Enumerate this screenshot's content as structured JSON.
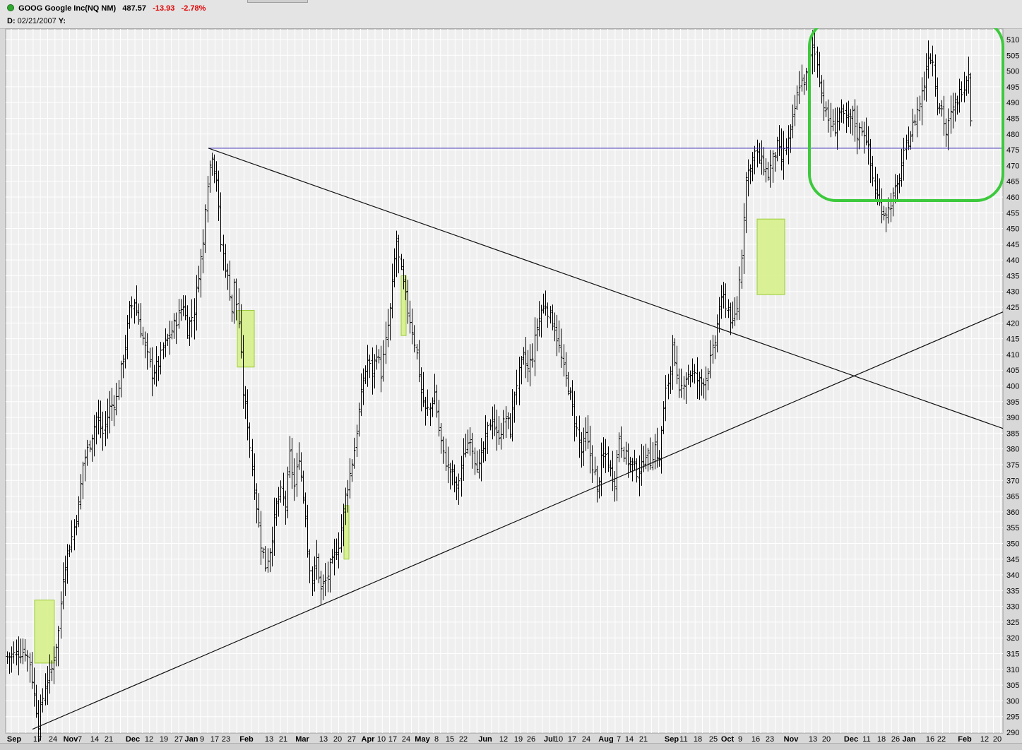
{
  "header": {
    "symbol": "GOOG",
    "name": "Google Inc(NQ NM)",
    "last": "487.57",
    "change": "-13.93",
    "pct": "-2.78%",
    "date_label": "D:",
    "date": "02/21/2007",
    "y_label": "Y:"
  },
  "chart_data": {
    "type": "ohlc",
    "period": "daily",
    "ylim": [
      290,
      513
    ],
    "y_ticks": [
      290,
      295,
      300,
      305,
      310,
      315,
      320,
      325,
      330,
      335,
      340,
      345,
      350,
      355,
      360,
      365,
      370,
      375,
      380,
      385,
      390,
      395,
      400,
      405,
      410,
      415,
      420,
      425,
      430,
      435,
      440,
      445,
      450,
      455,
      460,
      465,
      470,
      475,
      480,
      485,
      490,
      495,
      500,
      505,
      510
    ],
    "x_labels": [
      {
        "t": "Sep",
        "b": true
      },
      {
        "t": "17",
        "b": false
      },
      {
        "t": "24",
        "b": false
      },
      {
        "t": "Nov",
        "b": true
      },
      {
        "t": "7",
        "b": false
      },
      {
        "t": "14",
        "b": false
      },
      {
        "t": "21",
        "b": false
      },
      {
        "t": "Dec",
        "b": true
      },
      {
        "t": "12",
        "b": false
      },
      {
        "t": "19",
        "b": false
      },
      {
        "t": "27",
        "b": false
      },
      {
        "t": "Jan",
        "b": true
      },
      {
        "t": "9",
        "b": false
      },
      {
        "t": "17",
        "b": false
      },
      {
        "t": "23",
        "b": false
      },
      {
        "t": "Feb",
        "b": true
      },
      {
        "t": "13",
        "b": false
      },
      {
        "t": "21",
        "b": false
      },
      {
        "t": "Mar",
        "b": true
      },
      {
        "t": "13",
        "b": false
      },
      {
        "t": "20",
        "b": false
      },
      {
        "t": "27",
        "b": false
      },
      {
        "t": "Apr",
        "b": true
      },
      {
        "t": "10",
        "b": false
      },
      {
        "t": "17",
        "b": false
      },
      {
        "t": "24",
        "b": false
      },
      {
        "t": "May",
        "b": true
      },
      {
        "t": "8",
        "b": false
      },
      {
        "t": "15",
        "b": false
      },
      {
        "t": "22",
        "b": false
      },
      {
        "t": "Jun",
        "b": true
      },
      {
        "t": "12",
        "b": false
      },
      {
        "t": "19",
        "b": false
      },
      {
        "t": "26",
        "b": false
      },
      {
        "t": "Jul",
        "b": true
      },
      {
        "t": "10",
        "b": false
      },
      {
        "t": "17",
        "b": false
      },
      {
        "t": "24",
        "b": false
      },
      {
        "t": "Aug",
        "b": true
      },
      {
        "t": "7",
        "b": false
      },
      {
        "t": "14",
        "b": false
      },
      {
        "t": "21",
        "b": false
      },
      {
        "t": "Sep",
        "b": true
      },
      {
        "t": "11",
        "b": false
      },
      {
        "t": "18",
        "b": false
      },
      {
        "t": "25",
        "b": false
      },
      {
        "t": "Oct",
        "b": true
      },
      {
        "t": "9",
        "b": false
      },
      {
        "t": "16",
        "b": false
      },
      {
        "t": "23",
        "b": false
      },
      {
        "t": "Nov",
        "b": true
      },
      {
        "t": "13",
        "b": false
      },
      {
        "t": "20",
        "b": false
      },
      {
        "t": "Dec",
        "b": true
      },
      {
        "t": "11",
        "b": false
      },
      {
        "t": "18",
        "b": false
      },
      {
        "t": "26",
        "b": false
      },
      {
        "t": "Jan",
        "b": true
      },
      {
        "t": "16",
        "b": false
      },
      {
        "t": "22",
        "b": false
      },
      {
        "t": "Feb",
        "b": true
      },
      {
        "t": "12",
        "b": false
      },
      {
        "t": "20",
        "b": false
      }
    ],
    "price_path": [
      [
        0,
        314
      ],
      [
        8,
        316
      ],
      [
        10,
        312
      ],
      [
        12,
        302
      ],
      [
        14,
        293
      ],
      [
        17,
        305
      ],
      [
        20,
        310
      ],
      [
        23,
        322
      ],
      [
        25,
        340
      ],
      [
        27,
        347
      ],
      [
        29,
        352
      ],
      [
        32,
        362
      ],
      [
        34,
        375
      ],
      [
        37,
        382
      ],
      [
        40,
        390
      ],
      [
        43,
        385
      ],
      [
        46,
        393
      ],
      [
        49,
        396
      ],
      [
        51,
        405
      ],
      [
        53,
        413
      ],
      [
        55,
        424
      ],
      [
        57,
        427
      ],
      [
        60,
        418
      ],
      [
        62,
        412
      ],
      [
        65,
        404
      ],
      [
        68,
        407
      ],
      [
        70,
        412
      ],
      [
        73,
        416
      ],
      [
        76,
        421
      ],
      [
        79,
        426
      ],
      [
        81,
        418
      ],
      [
        84,
        424
      ],
      [
        86,
        436
      ],
      [
        88,
        445
      ],
      [
        89,
        458
      ],
      [
        90,
        465
      ],
      [
        91,
        470
      ],
      [
        92,
        474
      ],
      [
        93,
        469
      ],
      [
        94,
        466
      ],
      [
        96,
        445
      ],
      [
        98,
        438
      ],
      [
        100,
        430
      ],
      [
        101,
        424
      ],
      [
        102,
        432
      ],
      [
        104,
        420
      ],
      [
        106,
        398
      ],
      [
        108,
        388
      ],
      [
        110,
        374
      ],
      [
        112,
        362
      ],
      [
        114,
        350
      ],
      [
        116,
        343
      ],
      [
        118,
        348
      ],
      [
        121,
        362
      ],
      [
        123,
        366
      ],
      [
        125,
        362
      ],
      [
        127,
        378
      ],
      [
        129,
        368
      ],
      [
        131,
        378
      ],
      [
        133,
        365
      ],
      [
        134,
        360
      ],
      [
        135,
        348
      ],
      [
        137,
        338
      ],
      [
        139,
        345
      ],
      [
        141,
        335
      ],
      [
        143,
        338
      ],
      [
        145,
        342
      ],
      [
        147,
        346
      ],
      [
        149,
        350
      ],
      [
        152,
        365
      ],
      [
        154,
        372
      ],
      [
        156,
        380
      ],
      [
        158,
        392
      ],
      [
        160,
        402
      ],
      [
        162,
        408
      ],
      [
        164,
        404
      ],
      [
        166,
        411
      ],
      [
        168,
        404
      ],
      [
        170,
        414
      ],
      [
        172,
        424
      ],
      [
        174,
        440
      ],
      [
        175,
        446
      ],
      [
        176,
        440
      ],
      [
        178,
        432
      ],
      [
        180,
        424
      ],
      [
        182,
        418
      ],
      [
        184,
        410
      ],
      [
        186,
        398
      ],
      [
        188,
        392
      ],
      [
        190,
        393
      ],
      [
        192,
        398
      ],
      [
        194,
        386
      ],
      [
        196,
        378
      ],
      [
        198,
        374
      ],
      [
        200,
        372
      ],
      [
        202,
        367
      ],
      [
        204,
        374
      ],
      [
        206,
        380
      ],
      [
        208,
        384
      ],
      [
        210,
        377
      ],
      [
        212,
        374
      ],
      [
        214,
        380
      ],
      [
        216,
        386
      ],
      [
        218,
        390
      ],
      [
        220,
        384
      ],
      [
        222,
        386
      ],
      [
        224,
        390
      ],
      [
        226,
        386
      ],
      [
        228,
        398
      ],
      [
        230,
        404
      ],
      [
        232,
        409
      ],
      [
        234,
        405
      ],
      [
        236,
        410
      ],
      [
        238,
        419
      ],
      [
        240,
        424
      ],
      [
        242,
        426
      ],
      [
        244,
        422
      ],
      [
        246,
        419
      ],
      [
        248,
        412
      ],
      [
        250,
        405
      ],
      [
        252,
        400
      ],
      [
        254,
        393
      ],
      [
        256,
        386
      ],
      [
        258,
        379
      ],
      [
        260,
        384
      ],
      [
        262,
        378
      ],
      [
        264,
        372
      ],
      [
        265,
        366
      ],
      [
        267,
        376
      ],
      [
        269,
        378
      ],
      [
        271,
        373
      ],
      [
        273,
        370
      ],
      [
        275,
        384
      ],
      [
        277,
        379
      ],
      [
        279,
        376
      ],
      [
        281,
        375
      ],
      [
        283,
        373
      ],
      [
        285,
        374
      ],
      [
        287,
        379
      ],
      [
        289,
        376
      ],
      [
        291,
        381
      ],
      [
        293,
        376
      ],
      [
        294,
        386
      ],
      [
        296,
        398
      ],
      [
        298,
        405
      ],
      [
        299,
        415
      ],
      [
        300,
        406
      ],
      [
        302,
        397
      ],
      [
        304,
        402
      ],
      [
        306,
        404
      ],
      [
        308,
        404
      ],
      [
        310,
        402
      ],
      [
        312,
        401
      ],
      [
        314,
        403
      ],
      [
        316,
        408
      ],
      [
        318,
        414
      ],
      [
        320,
        425
      ],
      [
        322,
        428
      ],
      [
        324,
        424
      ],
      [
        326,
        419
      ],
      [
        328,
        425
      ],
      [
        330,
        442
      ],
      [
        331,
        455
      ],
      [
        332,
        466
      ],
      [
        334,
        470
      ],
      [
        336,
        474
      ],
      [
        338,
        472
      ],
      [
        340,
        470
      ],
      [
        342,
        467
      ],
      [
        344,
        472
      ],
      [
        346,
        476
      ],
      [
        348,
        472
      ],
      [
        350,
        476
      ],
      [
        352,
        480
      ],
      [
        354,
        488
      ],
      [
        356,
        496
      ],
      [
        358,
        497
      ],
      [
        360,
        500
      ],
      [
        362,
        508
      ],
      [
        364,
        503
      ],
      [
        366,
        493
      ],
      [
        368,
        486
      ],
      [
        370,
        483
      ],
      [
        372,
        482
      ],
      [
        374,
        487
      ],
      [
        376,
        485
      ],
      [
        378,
        484
      ],
      [
        380,
        486
      ],
      [
        382,
        480
      ],
      [
        384,
        482
      ],
      [
        386,
        479
      ],
      [
        388,
        470
      ],
      [
        390,
        462
      ],
      [
        392,
        458
      ],
      [
        394,
        455
      ],
      [
        396,
        456
      ],
      [
        398,
        460
      ],
      [
        400,
        463
      ],
      [
        402,
        470
      ],
      [
        404,
        476
      ],
      [
        406,
        480
      ],
      [
        408,
        485
      ],
      [
        410,
        490
      ],
      [
        412,
        496
      ],
      [
        414,
        506
      ],
      [
        416,
        503
      ],
      [
        418,
        490
      ],
      [
        420,
        488
      ],
      [
        422,
        480
      ],
      [
        424,
        486
      ],
      [
        426,
        489
      ],
      [
        428,
        493
      ],
      [
        430,
        496
      ],
      [
        432,
        500
      ],
      [
        433,
        486
      ]
    ],
    "trend_lines": [
      {
        "name": "descending",
        "from": [
          "Jan 9",
          475.5
        ],
        "to": [
          "right-edge",
          386.5
        ]
      },
      {
        "name": "ascending",
        "from": [
          "Sep 17",
          291
        ],
        "to": [
          "right-edge",
          423.5
        ]
      },
      {
        "name": "horizontal",
        "value": 475.5
      }
    ],
    "highlight_boxes": [
      {
        "y0": 312,
        "y1": 332
      },
      {
        "y0": 406,
        "y1": 424
      },
      {
        "y0": 345,
        "y1": 362
      },
      {
        "y0": 416,
        "y1": 435
      },
      {
        "y0": 429,
        "y1": 453
      }
    ],
    "colors": {
      "background": "#efefef",
      "grid": "#ffffff",
      "bars": "#000000",
      "trend": "#111111",
      "horizontal": "#3b2db8",
      "highlight_fill": "#d6f08a",
      "highlight_stroke": "#9ccc3a",
      "consolidation": "#3cc93c"
    }
  }
}
